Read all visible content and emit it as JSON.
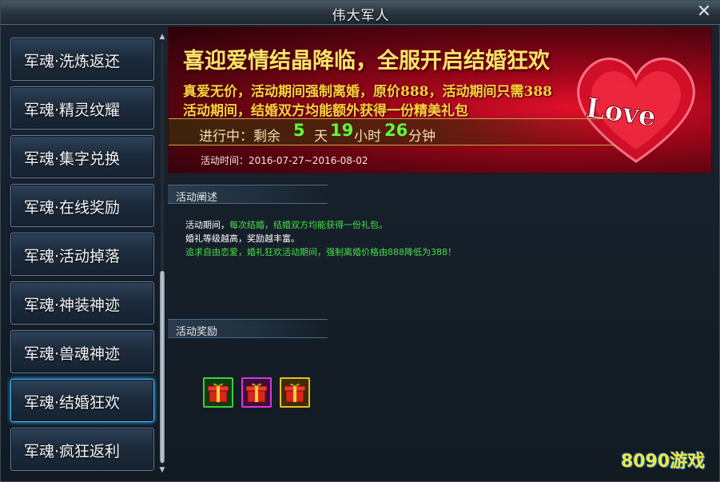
{
  "window": {
    "title": "伟大军人",
    "close_label": "✕"
  },
  "sidebar": {
    "items": [
      {
        "label": "军魂·洗炼返还"
      },
      {
        "label": "军魂·精灵纹耀"
      },
      {
        "label": "军魂·集字兑换"
      },
      {
        "label": "军魂·在线奖励"
      },
      {
        "label": "军魂·活动掉落"
      },
      {
        "label": "军魂·神装神迹"
      },
      {
        "label": "军魂·兽魂神迹"
      },
      {
        "label": "军魂·结婚狂欢"
      },
      {
        "label": "军魂·疯狂返利"
      }
    ],
    "active_index": 7,
    "scroll_up": "▲",
    "scroll_down": "▼"
  },
  "banner": {
    "title": "喜迎爱情结晶降临，全服开启结婚狂欢",
    "line1": "真爱无价，活动期间强制离婚，原价888，活动期间只需388",
    "line2": "活动期间，结婚双方均能额外获得一份精美礼包",
    "countdown": {
      "prefix": "进行中：剩余",
      "days": "5",
      "days_unit": "天",
      "hours": "19",
      "hours_unit": "小时",
      "minutes": "26",
      "minutes_unit": "分钟"
    },
    "activity_time": "活动时间：2016-07-27~2016-08-02",
    "love_text": "Love"
  },
  "description": {
    "header": "活动阐述",
    "line1_white": "活动期间，",
    "line1_green": "每次结婚，结婚双方均能获得一份礼包。",
    "line2": "婚礼等级越高，奖励越丰富。",
    "line3": "追求自由恋爱，婚礼狂欢活动期间，强制离婚价格由888降低为388！"
  },
  "rewards": {
    "header": "活动奖励",
    "items": [
      {
        "icon": "gift-box-green-icon",
        "border_color": "#3ad13a"
      },
      {
        "icon": "gift-box-purple-icon",
        "border_color": "#d23ad8"
      },
      {
        "icon": "gift-box-gold-icon",
        "border_color": "#e8c21a"
      }
    ]
  },
  "watermark": {
    "text": "8090游戏"
  },
  "colors": {
    "highlight_green": "#46e04a",
    "banner_gold": "#ffd23a",
    "active_border": "#3fc3ff"
  }
}
